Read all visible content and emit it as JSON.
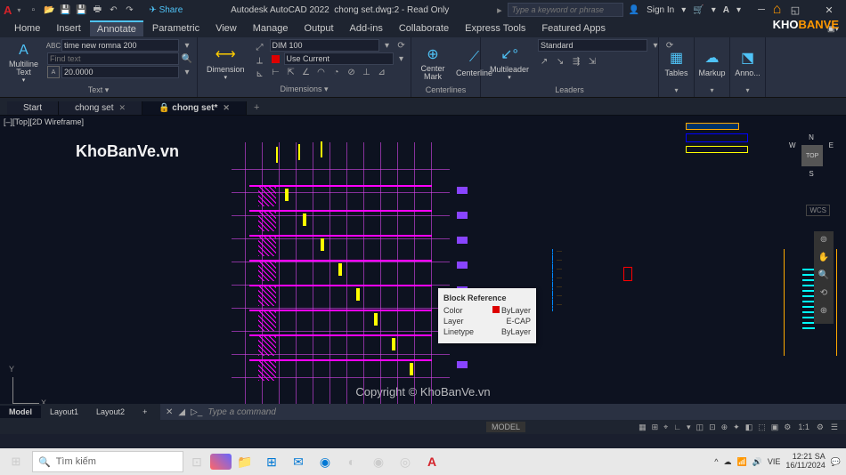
{
  "titlebar": {
    "app": "Autodesk AutoCAD 2022",
    "doc": "chong set.dwg:2 - Read Only",
    "share": "Share",
    "search_ph": "Type a keyword or phrase",
    "signin": "Sign In"
  },
  "menu": {
    "items": [
      "Home",
      "Insert",
      "Annotate",
      "Parametric",
      "View",
      "Manage",
      "Output",
      "Add-ins",
      "Collaborate",
      "Express Tools",
      "Featured Apps"
    ],
    "active": 2
  },
  "ribbon": {
    "text": {
      "label": "Text ▾",
      "btn": "Multiline\nText",
      "font": "time new romna 200",
      "find_ph": "Find text",
      "height": "20.0000"
    },
    "dim": {
      "label": "Dimensions ▾",
      "btn": "Dimension",
      "style": "DIM 100",
      "layer": "Use Current"
    },
    "center": {
      "label": "Centerlines",
      "b1": "Center\nMark",
      "b2": "Centerline"
    },
    "leader": {
      "label": "Leaders",
      "btn": "Multileader",
      "style": "Standard"
    },
    "tables": {
      "label": "Tables"
    },
    "markup": {
      "label": "Markup"
    },
    "anno": {
      "label": "Anno..."
    }
  },
  "tabs": {
    "items": [
      "Start",
      "chong set",
      "🔒 chong set*"
    ],
    "active": 2
  },
  "viewport": "[–][Top][2D Wireframe]",
  "watermark1": "KhoBanVe.vn",
  "watermark2": "Copyright © KhoBanVe.vn",
  "tooltip": {
    "title": "Block Reference",
    "rows": [
      [
        "Color",
        "ByLayer"
      ],
      [
        "Layer",
        "E-CAP"
      ],
      [
        "Linetype",
        "ByLayer"
      ]
    ]
  },
  "viewcube": {
    "n": "N",
    "s": "S",
    "e": "E",
    "w": "W",
    "face": "TOP",
    "wcs": "WCS"
  },
  "ucs": {
    "x": "X",
    "y": "Y"
  },
  "cmd": {
    "prompt": "Type a command"
  },
  "layouts": {
    "items": [
      "Model",
      "Layout1",
      "Layout2"
    ],
    "active": 0
  },
  "status": {
    "model": "MODEL",
    "scale": "1:1",
    "items": [
      "▦",
      "⊞",
      "⌖",
      "∟",
      "▾",
      "◫",
      "⊡",
      "⊕",
      "✦",
      "◧",
      "⬚",
      "▣",
      "⚙"
    ]
  },
  "taskbar": {
    "search_ph": "Tìm kiếm",
    "tray": {
      "lang": "VIE",
      "time": "12:21 SA",
      "date": "16/11/2024"
    }
  },
  "brand": {
    "t1": "KHO",
    "t2": "BANVE"
  }
}
